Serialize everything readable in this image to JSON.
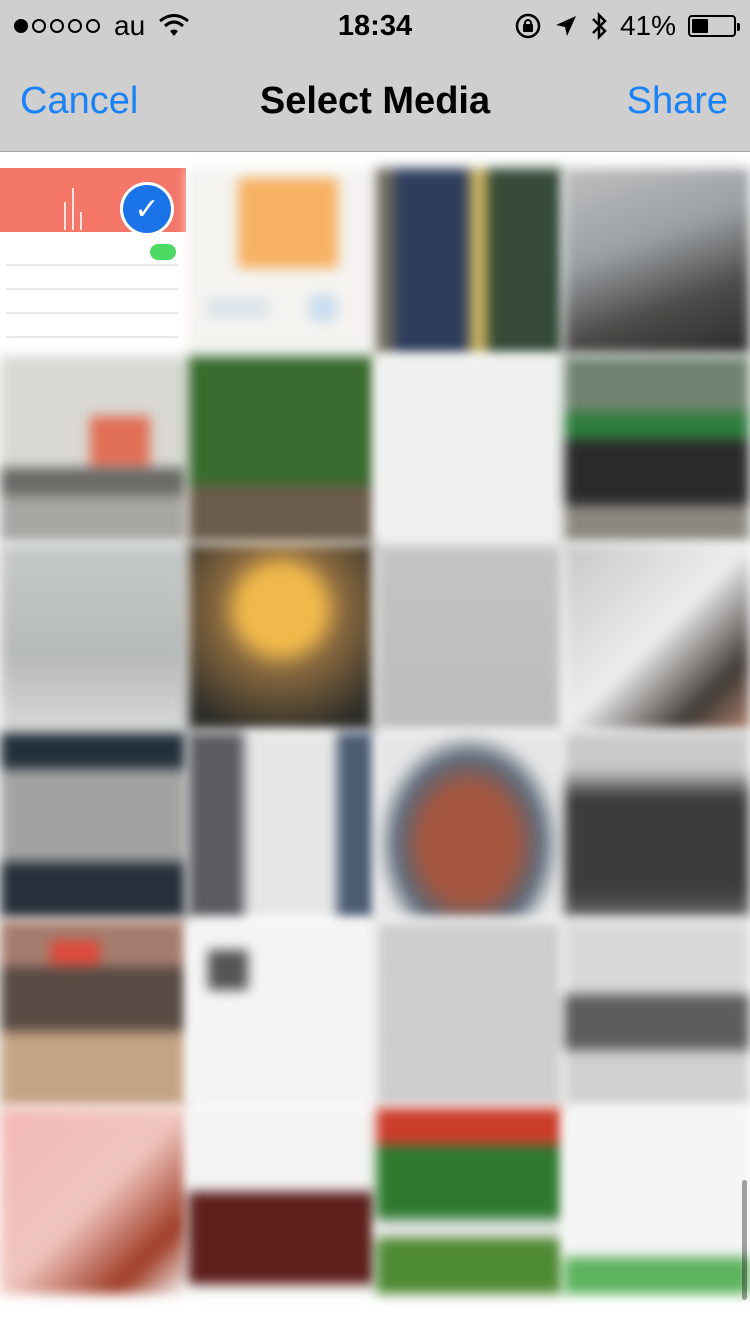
{
  "status_bar": {
    "carrier": "au",
    "signal_bars_filled": 1,
    "signal_bars_total": 5,
    "time": "18:34",
    "battery_percent_label": "41%",
    "battery_level": 0.41
  },
  "nav": {
    "cancel_label": "Cancel",
    "title": "Select Media",
    "share_label": "Share"
  },
  "media": {
    "selected_count": 1,
    "check_glyph": "✓"
  },
  "colors": {
    "accent": "#1a82f7",
    "bar_background": "#cfcfcf",
    "check_badge": "#1a74e8"
  }
}
